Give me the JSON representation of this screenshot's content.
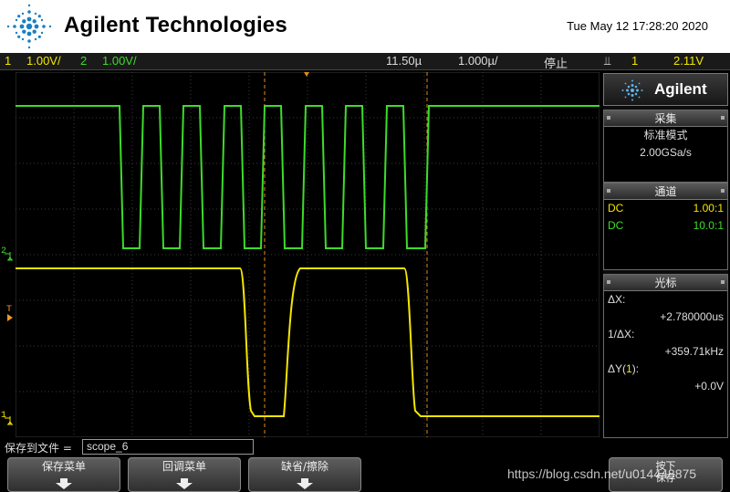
{
  "header": {
    "brand": "Agilent Technologies",
    "datetime": "Tue May 12 17:28:20 2020"
  },
  "status": {
    "ch1_num": "1",
    "ch1_scale": "1.00V/",
    "ch2_num": "2",
    "ch2_scale": "1.00V/",
    "time_offset": "11.50µ",
    "time_scale": "1.000µ/",
    "run_state": "停止",
    "trigger_icon": "⫫",
    "trigger_src": "1",
    "trigger_level": "2.11V"
  },
  "screen": {
    "ch1_marker": "1",
    "ch2_marker": "2",
    "trigger_marker": "T"
  },
  "panel": {
    "logo": "Agilent",
    "acquire": {
      "title": "采集",
      "mode": "标准模式",
      "rate": "2.00GSa/s"
    },
    "channels": {
      "title": "通道",
      "rows": [
        {
          "coupling": "DC",
          "probe": "1.00:1"
        },
        {
          "coupling": "DC",
          "probe": "10.0:1"
        }
      ]
    },
    "cursors": {
      "title": "光标",
      "dx_label": "ΔX:",
      "dx_value": "+2.780000us",
      "inv_dx_label": "1/ΔX:",
      "inv_dx_value": "+359.71kHz",
      "dy_label_prefix": "ΔY(",
      "dy_label_ch": "1",
      "dy_label_suffix": "):",
      "dy_value": "+0.0V"
    }
  },
  "bottom": {
    "filename_label": "保存到文件 =",
    "filename_value": "scope_6",
    "softkeys": [
      {
        "label": "保存菜单"
      },
      {
        "label": "回调菜单"
      },
      {
        "label": "缺省/擦除"
      },
      {
        "label": "按下\n保存"
      }
    ],
    "watermark": "https://blog.csdn.net/u014448875"
  },
  "colors": {
    "ch1": "#f2e600",
    "ch2": "#3ddc2a",
    "cursor": "#e08a1e",
    "grid": "#3a3a3a"
  },
  "icons": {
    "brand_logo": "agilent-spark-icon",
    "softkey_arrow": "down-arrow-icon"
  }
}
